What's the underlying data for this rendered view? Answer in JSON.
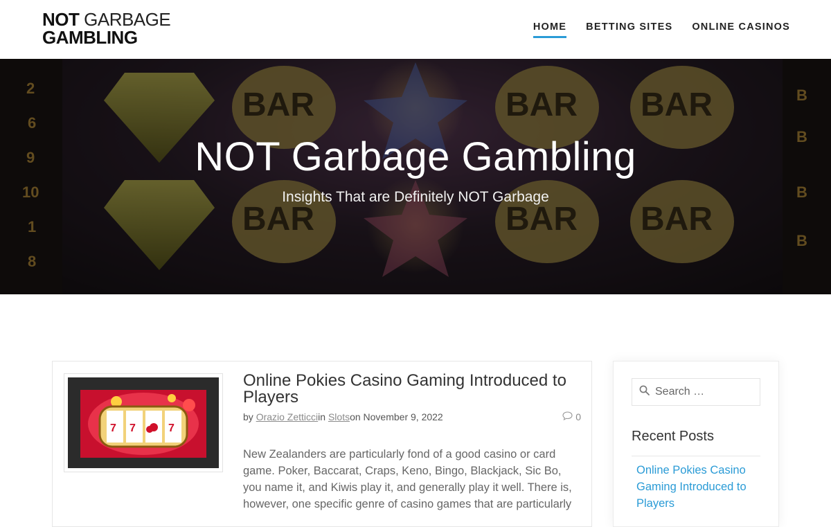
{
  "header": {
    "logo_line1_bold": "NOT",
    "logo_line1_light": "GARBAGE",
    "logo_line2": "GAMBLING",
    "nav": [
      {
        "label": "HOME"
      },
      {
        "label": "BETTING SITES"
      },
      {
        "label": "ONLINE CASINOS"
      }
    ],
    "accent_color": "#2a9bd6"
  },
  "hero": {
    "title": "NOT Garbage Gambling",
    "subtitle": "Insights That are Definitely NOT Garbage"
  },
  "post": {
    "title": "Online Pokies Casino Gaming Introduced to Players",
    "by_label": "by",
    "author": "Orazio Zetticci",
    "in_label": "in",
    "category": "Slots",
    "date_text": "on November 9, 2022",
    "comments_count": "0",
    "comment_icon": "comment-bubble-icon",
    "excerpt": "New Zealanders are particularly fond of a good casino or card game. Poker, Baccarat, Craps, Keno, Bingo, Blackjack, Sic Bo, you name it, and Kiwis play it, and generally play it well. There is, however, one specific genre of casino games that are particularly"
  },
  "sidebar": {
    "search_placeholder": "Search …",
    "search_icon": "search-icon",
    "recent_posts_title": "Recent Posts",
    "recent_posts": [
      {
        "label": "Online Pokies Casino Gaming Introduced to Players"
      }
    ]
  }
}
